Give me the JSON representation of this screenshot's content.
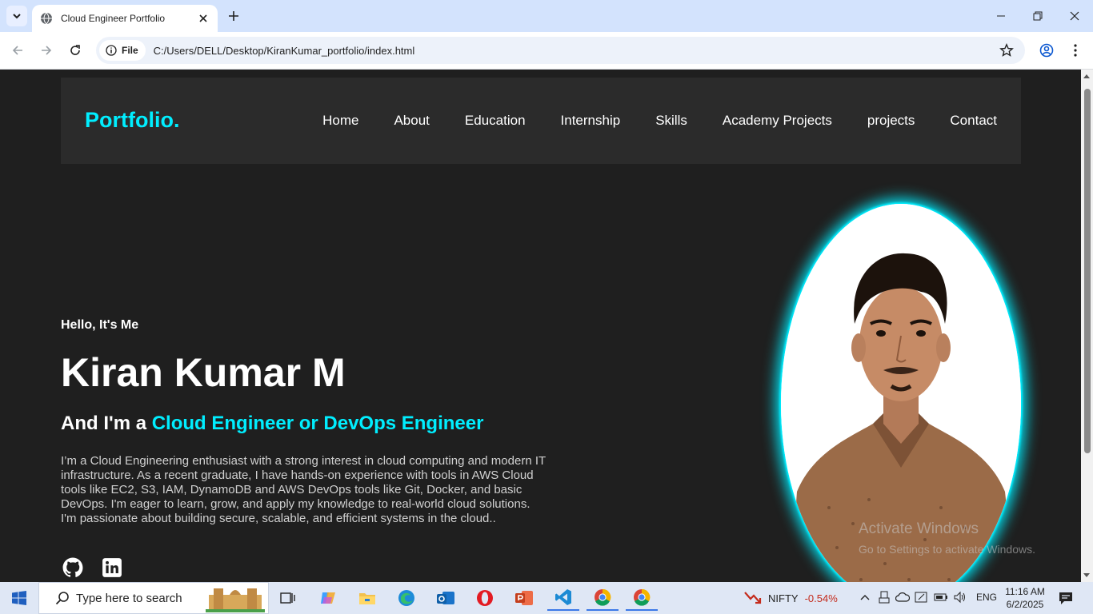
{
  "browser": {
    "tab_title": "Cloud Engineer Portfolio",
    "chip_label": "File",
    "url": "C:/Users/DELL/Desktop/KiranKumar_portfolio/index.html"
  },
  "page": {
    "logo": "Portfolio.",
    "nav": [
      "Home",
      "About",
      "Education",
      "Internship",
      "Skills",
      "Academy Projects",
      "projects",
      "Contact"
    ],
    "hello": "Hello, It's Me",
    "name": "Kiran Kumar M",
    "role_prefix": "And I'm a ",
    "role_accent": "Cloud Engineer or DevOps Engineer",
    "bio": "I’m a Cloud Engineering enthusiast with a strong interest in cloud computing and modern IT infrastructure. As a recent graduate, I have hands-on experience with tools in AWS Cloud tools like EC2, S3, IAM, DynamoDB and AWS DevOps tools like Git, Docker, and basic DevOps. I'm eager to learn, grow, and apply my knowledge to real-world cloud solutions. I'm passionate about building secure, scalable, and efficient systems in the cloud..",
    "accent_color": "#00eeff"
  },
  "watermark": {
    "line1": "Activate Windows",
    "line2": "Go to Settings to activate Windows."
  },
  "taskbar": {
    "search_placeholder": "Type here to search",
    "ticker_name": "NIFTY",
    "ticker_change": "-0.54%",
    "language": "ENG",
    "time": "11:16 AM",
    "date": "6/2/2025"
  }
}
